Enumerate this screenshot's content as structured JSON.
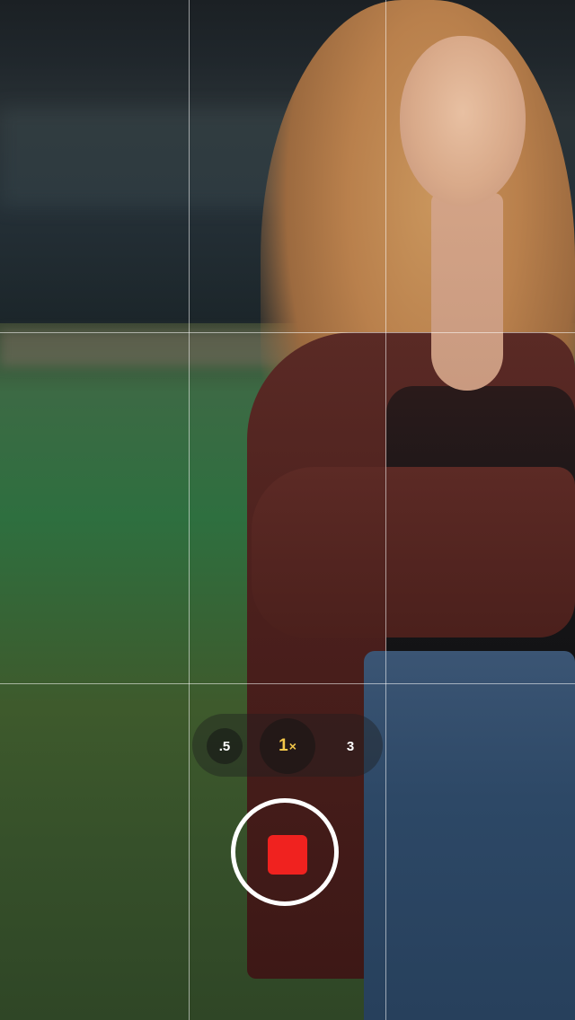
{
  "camera": {
    "mode": "video-recording",
    "grid_enabled": true,
    "zoom": {
      "options": [
        ".5",
        "1",
        "3"
      ],
      "selected": "1",
      "selected_suffix": "×"
    },
    "record_button": {
      "state": "recording",
      "accent_color": "#f0221f"
    },
    "colors": {
      "active_zoom": "#f5c84a",
      "ring": "#ffffff"
    }
  }
}
